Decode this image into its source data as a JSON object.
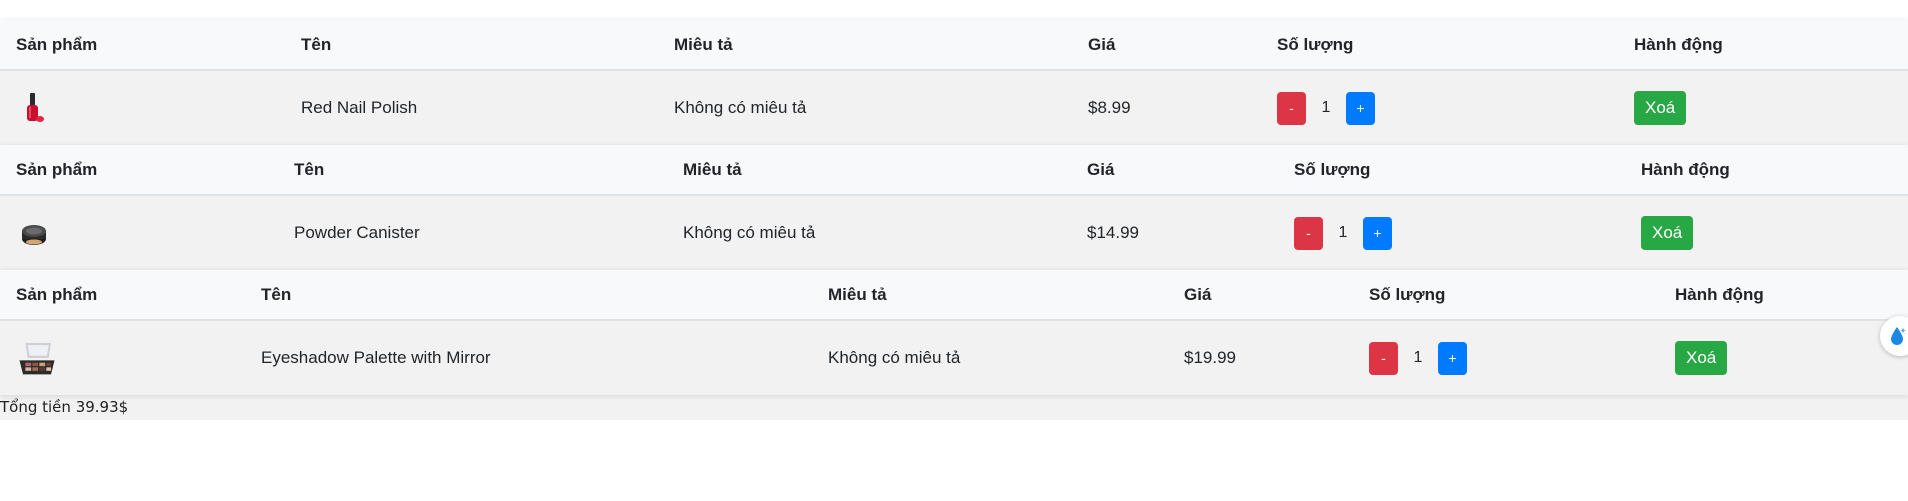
{
  "headers": {
    "product": "Sản phẩm",
    "name": "Tên",
    "description": "Miêu tả",
    "price": "Giá",
    "quantity": "Số lượng",
    "action": "Hành động"
  },
  "items": [
    {
      "name": "Red Nail Polish",
      "description": "Không có miêu tả",
      "price": "$8.99",
      "quantity": "1",
      "image_icon": "nail-polish-icon"
    },
    {
      "name": "Powder Canister",
      "description": "Không có miêu tả",
      "price": "$14.99",
      "quantity": "1",
      "image_icon": "powder-canister-icon"
    },
    {
      "name": "Eyeshadow Palette with Mirror",
      "description": "Không có miêu tả",
      "price": "$19.99",
      "quantity": "1",
      "image_icon": "eyeshadow-palette-icon"
    }
  ],
  "buttons": {
    "minus": "-",
    "plus": "+",
    "delete": "Xoá"
  },
  "total_text": "Tổng tiền 39.93$",
  "colors": {
    "minus": "#dc3545",
    "plus": "#007bff",
    "delete": "#28a745",
    "header_bg": "#f8f9fa",
    "row_bg": "#f2f2f2"
  }
}
